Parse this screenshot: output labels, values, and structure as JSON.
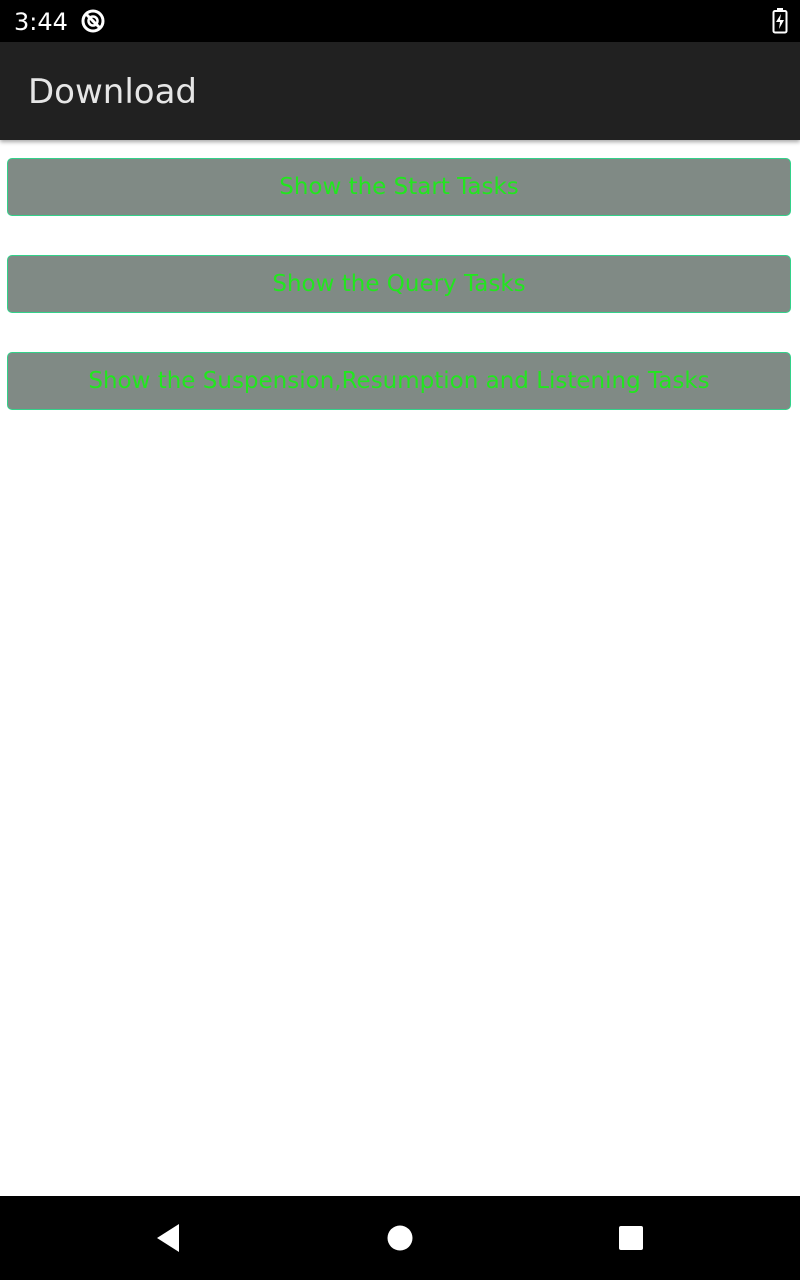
{
  "status_bar": {
    "time": "3:44",
    "icons": [
      "notification-ring-icon",
      "battery-charging-icon"
    ]
  },
  "app_bar": {
    "title": "Download"
  },
  "buttons": [
    {
      "label": "Show the Start Tasks"
    },
    {
      "label": "Show the Query Tasks"
    },
    {
      "label": "Show the Suspension,Resumption and Listening Tasks"
    }
  ],
  "nav_bar": {
    "icons": [
      "back-icon",
      "home-icon",
      "recents-icon"
    ]
  },
  "colors": {
    "button_bg": "#808a85",
    "button_text": "#22e61f",
    "button_border": "#33d18a",
    "app_bar_bg": "#212121",
    "status_bar_bg": "#000000"
  }
}
